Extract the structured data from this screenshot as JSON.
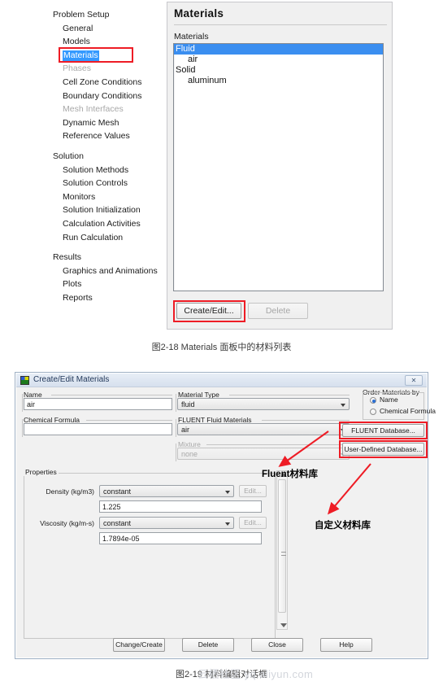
{
  "figure1": {
    "tree": {
      "sections": [
        {
          "heading": "Problem Setup",
          "items": [
            {
              "label": "General",
              "state": "normal"
            },
            {
              "label": "Models",
              "state": "normal"
            },
            {
              "label": "Materials",
              "state": "selected"
            },
            {
              "label": "Phases",
              "state": "disabled"
            },
            {
              "label": "Cell Zone Conditions",
              "state": "normal"
            },
            {
              "label": "Boundary Conditions",
              "state": "normal"
            },
            {
              "label": "Mesh Interfaces",
              "state": "disabled"
            },
            {
              "label": "Dynamic Mesh",
              "state": "normal"
            },
            {
              "label": "Reference Values",
              "state": "normal"
            }
          ]
        },
        {
          "heading": "Solution",
          "items": [
            {
              "label": "Solution Methods",
              "state": "normal"
            },
            {
              "label": "Solution Controls",
              "state": "normal"
            },
            {
              "label": "Monitors",
              "state": "normal"
            },
            {
              "label": "Solution Initialization",
              "state": "normal"
            },
            {
              "label": "Calculation Activities",
              "state": "normal"
            },
            {
              "label": "Run Calculation",
              "state": "normal"
            }
          ]
        },
        {
          "heading": "Results",
          "items": [
            {
              "label": "Graphics and Animations",
              "state": "normal"
            },
            {
              "label": "Plots",
              "state": "normal"
            },
            {
              "label": "Reports",
              "state": "normal"
            }
          ]
        }
      ]
    },
    "panel": {
      "title": "Materials",
      "list_label": "Materials",
      "list": [
        {
          "label": "Fluid",
          "indent": 0,
          "selected": true
        },
        {
          "label": "air",
          "indent": 1,
          "selected": false
        },
        {
          "label": "Solid",
          "indent": 0,
          "selected": false
        },
        {
          "label": "aluminum",
          "indent": 1,
          "selected": false
        }
      ],
      "buttons": {
        "create_edit": "Create/Edit...",
        "delete": "Delete"
      }
    }
  },
  "caption1": "图2-18 Materials 面板中的材料列表",
  "dialog": {
    "title": "Create/Edit Materials",
    "close_glyph": "✕",
    "name": {
      "label": "Name",
      "value": "air"
    },
    "chemical_formula": {
      "label": "Chemical Formula",
      "value": ""
    },
    "material_type": {
      "label": "Material Type",
      "value": "fluid"
    },
    "fluent_fluid_materials": {
      "label": "FLUENT Fluid Materials",
      "value": "air"
    },
    "mixture": {
      "label": "Mixture",
      "value": "none"
    },
    "order_materials_by": {
      "label": "Order Materials by",
      "options": [
        {
          "label": "Name",
          "selected": true
        },
        {
          "label": "Chemical Formula",
          "selected": false
        }
      ]
    },
    "database_buttons": {
      "fluent": "FLUENT Database...",
      "user_defined": "User-Defined Database..."
    },
    "properties": {
      "label": "Properties",
      "rows": [
        {
          "name": "Density (kg/m3)",
          "method": "constant",
          "edit": "Edit...",
          "value": "1.225"
        },
        {
          "name": "Viscosity (kg/m-s)",
          "method": "constant",
          "edit": "Edit...",
          "value": "1.7894e-05"
        }
      ]
    },
    "bottom_buttons": [
      {
        "label": "Change/Create"
      },
      {
        "label": "Delete"
      },
      {
        "label": "Close"
      },
      {
        "label": "Help"
      }
    ]
  },
  "annotations": {
    "fluent_library": "Fluent材料库",
    "user_library": "自定义材料库",
    "accent_red": "#ee1c25"
  },
  "caption2": "图2-19 材料编辑对话框",
  "watermark": "云栖社区 yq.aliyun.com"
}
